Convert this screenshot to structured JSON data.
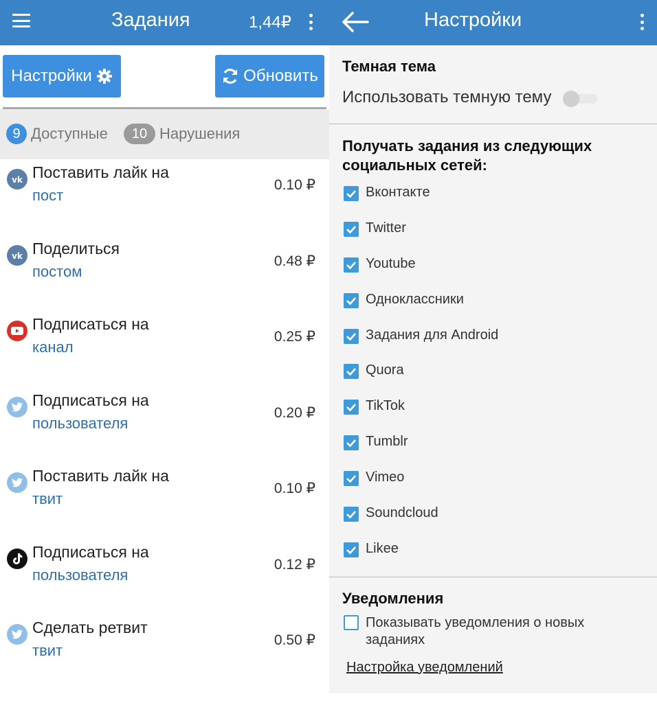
{
  "left": {
    "title": "Задания",
    "balance": "1,44₽",
    "buttons": {
      "settings": "Настройки",
      "refresh": "Обновить"
    },
    "tabs": [
      {
        "count": "9",
        "label": "Доступные"
      },
      {
        "count": "10",
        "label": "Нарушения"
      }
    ],
    "tasks": [
      {
        "network": "vk-icon",
        "line1": "Поставить лайк на",
        "line2": "пост",
        "price": "0.10 ₽"
      },
      {
        "network": "vk-icon",
        "line1": "Поделиться",
        "line2": "постом",
        "price": "0.48 ₽"
      },
      {
        "network": "youtube-icon",
        "line1": "Подписаться на",
        "line2": "канал",
        "price": "0.25 ₽"
      },
      {
        "network": "twitter-icon",
        "line1": "Подписаться на",
        "line2": "пользователя",
        "price": "0.20 ₽"
      },
      {
        "network": "twitter-icon",
        "line1": "Поставить лайк на",
        "line2": "твит",
        "price": "0.10 ₽"
      },
      {
        "network": "tiktok-icon",
        "line1": "Подписаться на",
        "line2": "пользователя",
        "price": "0.12 ₽"
      },
      {
        "network": "twitter-icon",
        "line1": "Сделать ретвит",
        "line2": "твит",
        "price": "0.50 ₽"
      }
    ]
  },
  "right": {
    "title": "Настройки",
    "dark_theme": {
      "section_title": "Темная тема",
      "label": "Использовать темную тему",
      "enabled": false
    },
    "networks": {
      "section_title_1": "Получать задания из следующих",
      "section_title_2": "социальных сетей:",
      "items": [
        {
          "label": "Вконтакте",
          "checked": true
        },
        {
          "label": "Twitter",
          "checked": true
        },
        {
          "label": "Youtube",
          "checked": true
        },
        {
          "label": "Одноклассники",
          "checked": true
        },
        {
          "label": "Задания для Android",
          "checked": true
        },
        {
          "label": "Quora",
          "checked": true
        },
        {
          "label": "TikTok",
          "checked": true
        },
        {
          "label": "Tumblr",
          "checked": true
        },
        {
          "label": "Vimeo",
          "checked": true
        },
        {
          "label": "Soundcloud",
          "checked": true
        },
        {
          "label": "Likee",
          "checked": true
        }
      ]
    },
    "notifications": {
      "section_title": "Уведомления",
      "option_line1": "Показывать уведомления о новых",
      "option_line2": "заданиях",
      "option_checked": false,
      "settings_link": "Настройка уведомлений"
    }
  },
  "colors": {
    "appbar": "#3a83c6",
    "button": "#3f8fe0",
    "checkbox": "#3f9ad9",
    "link_text": "#2d6fb0",
    "vk": "#5b7fa6",
    "youtube": "#d9302b",
    "twitter": "#8fbfe8",
    "tiktok": "#111111"
  }
}
